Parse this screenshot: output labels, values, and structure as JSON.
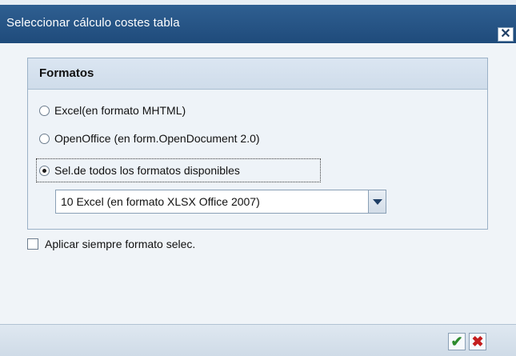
{
  "dialog": {
    "title": "Seleccionar cálculo costes tabla",
    "close_icon": "close-icon"
  },
  "formats": {
    "group_title": "Formatos",
    "options": [
      {
        "label": "Excel(en formato MHTML)",
        "selected": false
      },
      {
        "label": "OpenOffice (en form.OpenDocument 2.0)",
        "selected": false
      },
      {
        "label": "Sel.de todos los formatos disponibles",
        "selected": true
      }
    ],
    "dropdown_value": "10 Excel (en formato XLSX Office 2007)"
  },
  "always_apply": {
    "label": "Aplicar siempre formato selec.",
    "checked": false
  },
  "footer": {
    "ok_icon": "checkmark-icon",
    "cancel_icon": "cancel-x-icon",
    "ok_color": "#2e8b2e",
    "cancel_color": "#c41e1e"
  }
}
